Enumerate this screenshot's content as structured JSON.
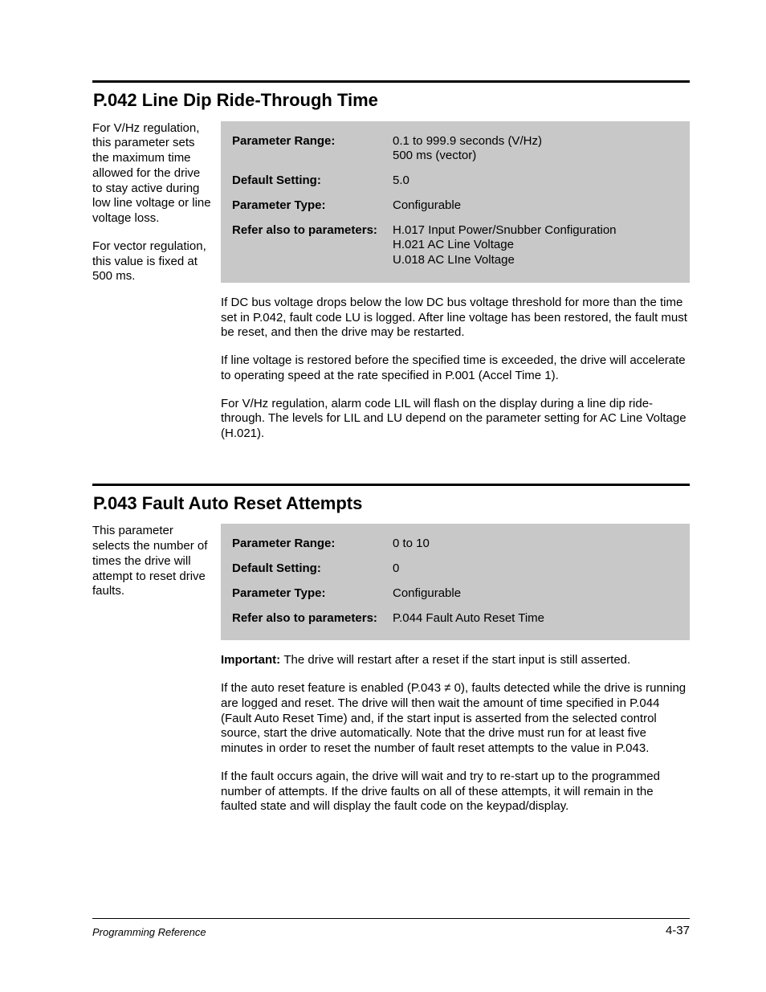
{
  "sections": [
    {
      "title": "P.042 Line Dip Ride-Through Time",
      "side": [
        "For V/Hz regulation, this parameter sets the maximum time allowed for the drive to stay active during low line voltage or line voltage loss.",
        "For vector regulation, this value is fixed at 500 ms."
      ],
      "rows": {
        "range_label": "Parameter Range:",
        "range_lines": [
          "0.1 to 999.9 seconds (V/Hz)",
          "500 ms (vector)"
        ],
        "default_label": "Default Setting:",
        "default_value": "5.0",
        "type_label": "Parameter Type:",
        "type_value": "Configurable",
        "refer_label": "Refer also to parameters:",
        "refer_lines": [
          "H.017 Input Power/Snubber Configuration",
          "H.021 AC Line Voltage",
          "U.018 AC LIne Voltage"
        ]
      },
      "desc": [
        "If DC bus voltage drops below the low DC bus voltage threshold for more than the time set in P.042, fault code LU is logged. After line voltage has been restored, the fault must be reset, and then the drive may be restarted.",
        "If line voltage is restored before the specified time is exceeded, the drive will accelerate to operating speed at the rate specified in P.001 (Accel Time 1).",
        "For V/Hz regulation, alarm code LIL will flash on the display during a line dip ride-through. The levels for LIL and LU depend on the parameter setting for AC Line Voltage (H.021)."
      ]
    },
    {
      "title": "P.043 Fault Auto Reset Attempts",
      "side": [
        "This parameter selects the number of times the drive will attempt to reset drive faults."
      ],
      "rows": {
        "range_label": "Parameter Range:",
        "range_value": "0 to 10",
        "default_label": "Default Setting:",
        "default_value": "0",
        "type_label": "Parameter Type:",
        "type_value": "Configurable",
        "refer_label": "Refer also to parameters:",
        "refer_value": "P.044 Fault Auto Reset Time"
      },
      "important_label": "Important:",
      "important_text": "The drive will restart after a reset if the start input is still asserted.",
      "desc": [
        "If the auto reset feature is enabled (P.043 ≠ 0), faults detected while the drive is running are logged and reset. The drive will then wait the amount of time specified in P.044 (Fault Auto Reset Time) and, if the start input is asserted from the selected control source, start the drive automatically. Note that the drive must run for at least five minutes in order to reset the number of fault reset attempts to the value in P.043.",
        "If the fault occurs again, the drive will wait and try to re-start up to the programmed number of attempts. If the drive faults on all of these attempts, it will remain in the faulted state and will display the fault code on the keypad/display."
      ]
    }
  ],
  "footer": {
    "left": "Programming Reference",
    "right": "4-37"
  }
}
